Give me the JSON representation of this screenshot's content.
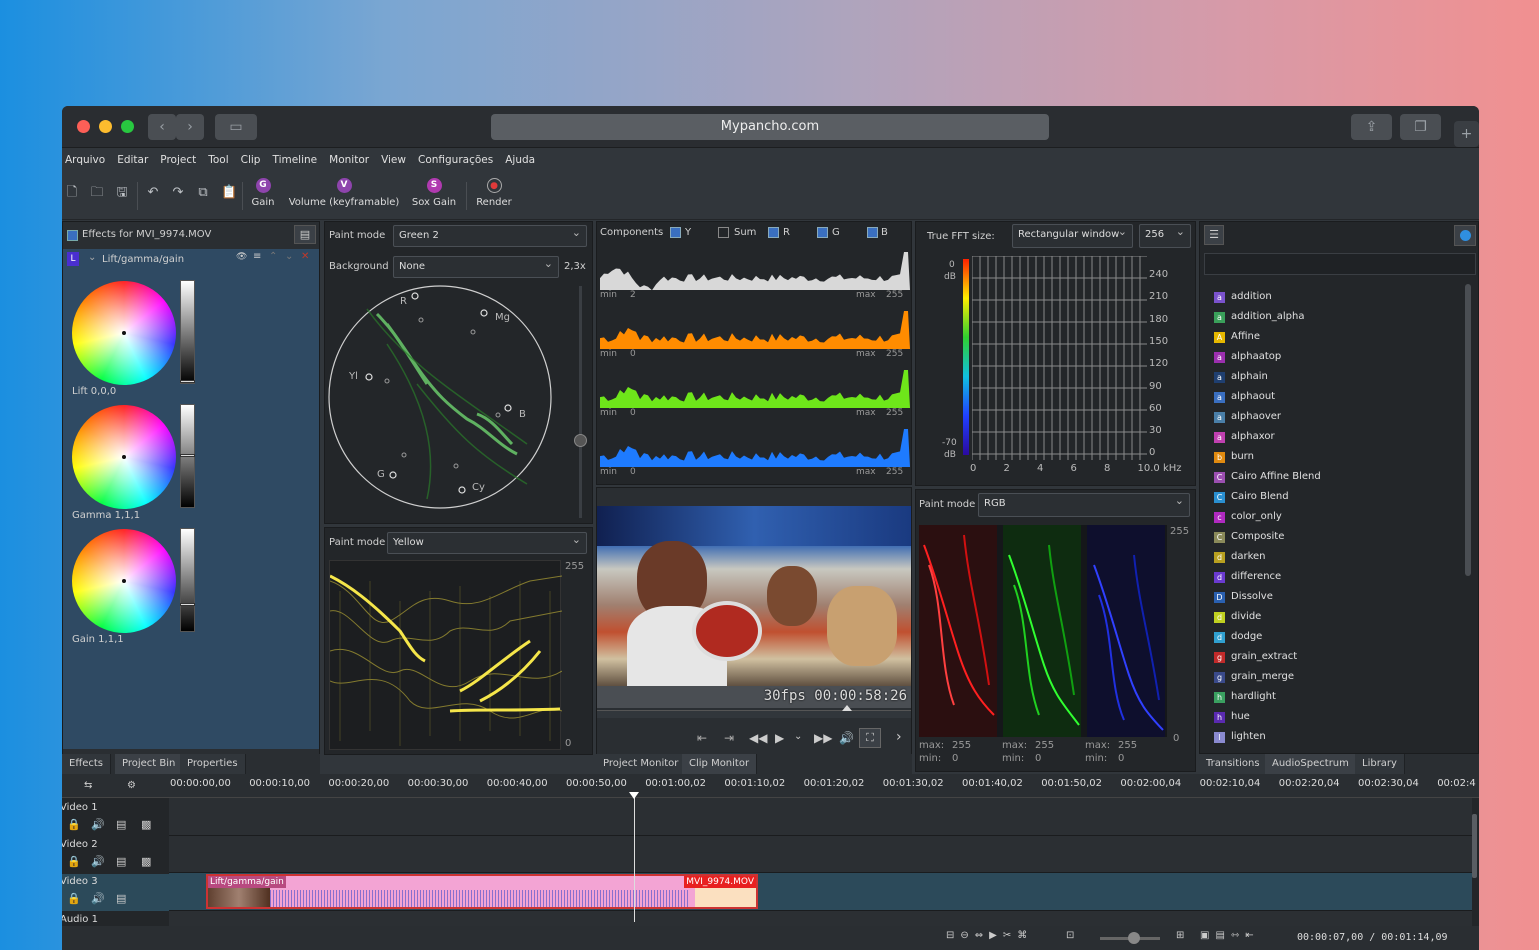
{
  "browser": {
    "url": "Mypancho.com"
  },
  "menu": [
    "Arquivo",
    "Editar",
    "Project",
    "Tool",
    "Clip",
    "Timeline",
    "Monitor",
    "View",
    "Configurações",
    "Ajuda"
  ],
  "toolbar": {
    "effects": [
      {
        "letter": "G",
        "label": "Gain"
      },
      {
        "letter": "V",
        "label": "Volume (keyframable)"
      },
      {
        "letter": "S",
        "label": "Sox Gain"
      }
    ],
    "render_label": "Render"
  },
  "effects_panel": {
    "title": "Effects for MVI_9974.MOV",
    "effect_badge": "L",
    "effect_name": "Lift/gamma/gain",
    "lift_label": "Lift 0,0,0",
    "gamma_label": "Gamma 1,1,1",
    "gain_label": "Gain 1,1,1",
    "tabs": [
      "Effects",
      "Project Bin",
      "Properties"
    ]
  },
  "vectorscope": {
    "paint_mode_label": "Paint mode",
    "paint_mode": "Green 2",
    "background_label": "Background",
    "background": "None",
    "zoom": "2,3x",
    "targets": {
      "r": "R",
      "mg": "Mg",
      "yl": "Yl",
      "b": "B",
      "g": "G",
      "cy": "Cy"
    }
  },
  "waveform": {
    "paint_mode_label": "Paint mode",
    "paint_mode": "Yellow",
    "max": "255",
    "min": "0"
  },
  "histogram": {
    "components_label": "Components",
    "y": "Y",
    "sum": "Sum",
    "r": "R",
    "g": "G",
    "b": "B",
    "rows": [
      {
        "min_label": "min",
        "min": "2",
        "max_label": "max",
        "max": "255",
        "color": "#d8d8d8"
      },
      {
        "min_label": "min",
        "min": "0",
        "max_label": "max",
        "max": "255",
        "color": "#ff8c00"
      },
      {
        "min_label": "min",
        "min": "0",
        "max_label": "max",
        "max": "255",
        "color": "#6ee61a"
      },
      {
        "min_label": "min",
        "min": "0",
        "max_label": "max",
        "max": "255",
        "color": "#1e7bff"
      }
    ]
  },
  "monitor": {
    "overlay": "30fps 00:00:58:26",
    "tabs": [
      "Project Monitor",
      "Clip Monitor"
    ]
  },
  "spectrum": {
    "fft_label": "True FFT size:",
    "window": "Rectangular window",
    "size": "256",
    "db_top": "0",
    "db_top_unit": "dB",
    "db_bottom": "-70",
    "db_bottom_unit": "dB",
    "y_ticks": [
      "240",
      "210",
      "180",
      "150",
      "120",
      "90",
      "60",
      "30",
      "0"
    ],
    "x_ticks": [
      "0",
      "2",
      "4",
      "6",
      "8",
      "10.0 kHz"
    ]
  },
  "rgb_parade": {
    "paint_mode_label": "Paint mode",
    "paint_mode": "RGB",
    "max": "255",
    "min": "0",
    "stats": [
      {
        "max_label": "max:",
        "max": "255",
        "min_label": "min:",
        "min": "0"
      },
      {
        "max_label": "max:",
        "max": "255",
        "min_label": "min:",
        "min": "0"
      },
      {
        "max_label": "max:",
        "max": "255",
        "min_label": "min:",
        "min": "0"
      }
    ]
  },
  "transitions": {
    "items": [
      {
        "badge": "a",
        "name": "addition",
        "color": "#7a52cc"
      },
      {
        "badge": "a",
        "name": "addition_alpha",
        "color": "#3aa05a"
      },
      {
        "badge": "A",
        "name": "Affine",
        "color": "#e6b800"
      },
      {
        "badge": "a",
        "name": "alphaatop",
        "color": "#9b2fae"
      },
      {
        "badge": "a",
        "name": "alphain",
        "color": "#1f3f70"
      },
      {
        "badge": "a",
        "name": "alphaout",
        "color": "#3a6fc0"
      },
      {
        "badge": "a",
        "name": "alphaover",
        "color": "#4a7fa8"
      },
      {
        "badge": "a",
        "name": "alphaxor",
        "color": "#c040b0"
      },
      {
        "badge": "b",
        "name": "burn",
        "color": "#e08a10"
      },
      {
        "badge": "C",
        "name": "Cairo Affine Blend",
        "color": "#9b4fb0"
      },
      {
        "badge": "C",
        "name": "Cairo Blend",
        "color": "#2a8fd0"
      },
      {
        "badge": "c",
        "name": "color_only",
        "color": "#b02ac0"
      },
      {
        "badge": "C",
        "name": "Composite",
        "color": "#8a8a5a"
      },
      {
        "badge": "d",
        "name": "darken",
        "color": "#b8a020"
      },
      {
        "badge": "d",
        "name": "difference",
        "color": "#6a3ad0"
      },
      {
        "badge": "D",
        "name": "Dissolve",
        "color": "#2a60b0"
      },
      {
        "badge": "d",
        "name": "divide",
        "color": "#c0d020"
      },
      {
        "badge": "d",
        "name": "dodge",
        "color": "#30a0d0"
      },
      {
        "badge": "g",
        "name": "grain_extract",
        "color": "#c02a2a"
      },
      {
        "badge": "g",
        "name": "grain_merge",
        "color": "#3a4a8a"
      },
      {
        "badge": "h",
        "name": "hardlight",
        "color": "#3aa060"
      },
      {
        "badge": "h",
        "name": "hue",
        "color": "#5a2ab0"
      },
      {
        "badge": "l",
        "name": "lighten",
        "color": "#8a8ad0"
      }
    ],
    "tabs": [
      "Transitions",
      "AudioSpectrum",
      "Library"
    ]
  },
  "timeline": {
    "ruler": [
      "00:00:00,00",
      "00:00:10,00",
      "00:00:20,00",
      "00:00:30,00",
      "00:00:40,00",
      "00:00:50,00",
      "00:01:00,02",
      "00:01:10,02",
      "00:01:20,02",
      "00:01:30,02",
      "00:01:40,02",
      "00:01:50,02",
      "00:02:00,04",
      "00:02:10,04",
      "00:02:20,04",
      "00:02:30,04",
      "00:02:4"
    ],
    "tracks": [
      "Video 1",
      "Video 2",
      "Video 3",
      "Audio 1"
    ],
    "clip_effect": "Lift/gamma/gain",
    "clip_name": "MVI_9974.MOV",
    "timecode": "00:00:07,00 / 00:01:14,09"
  }
}
